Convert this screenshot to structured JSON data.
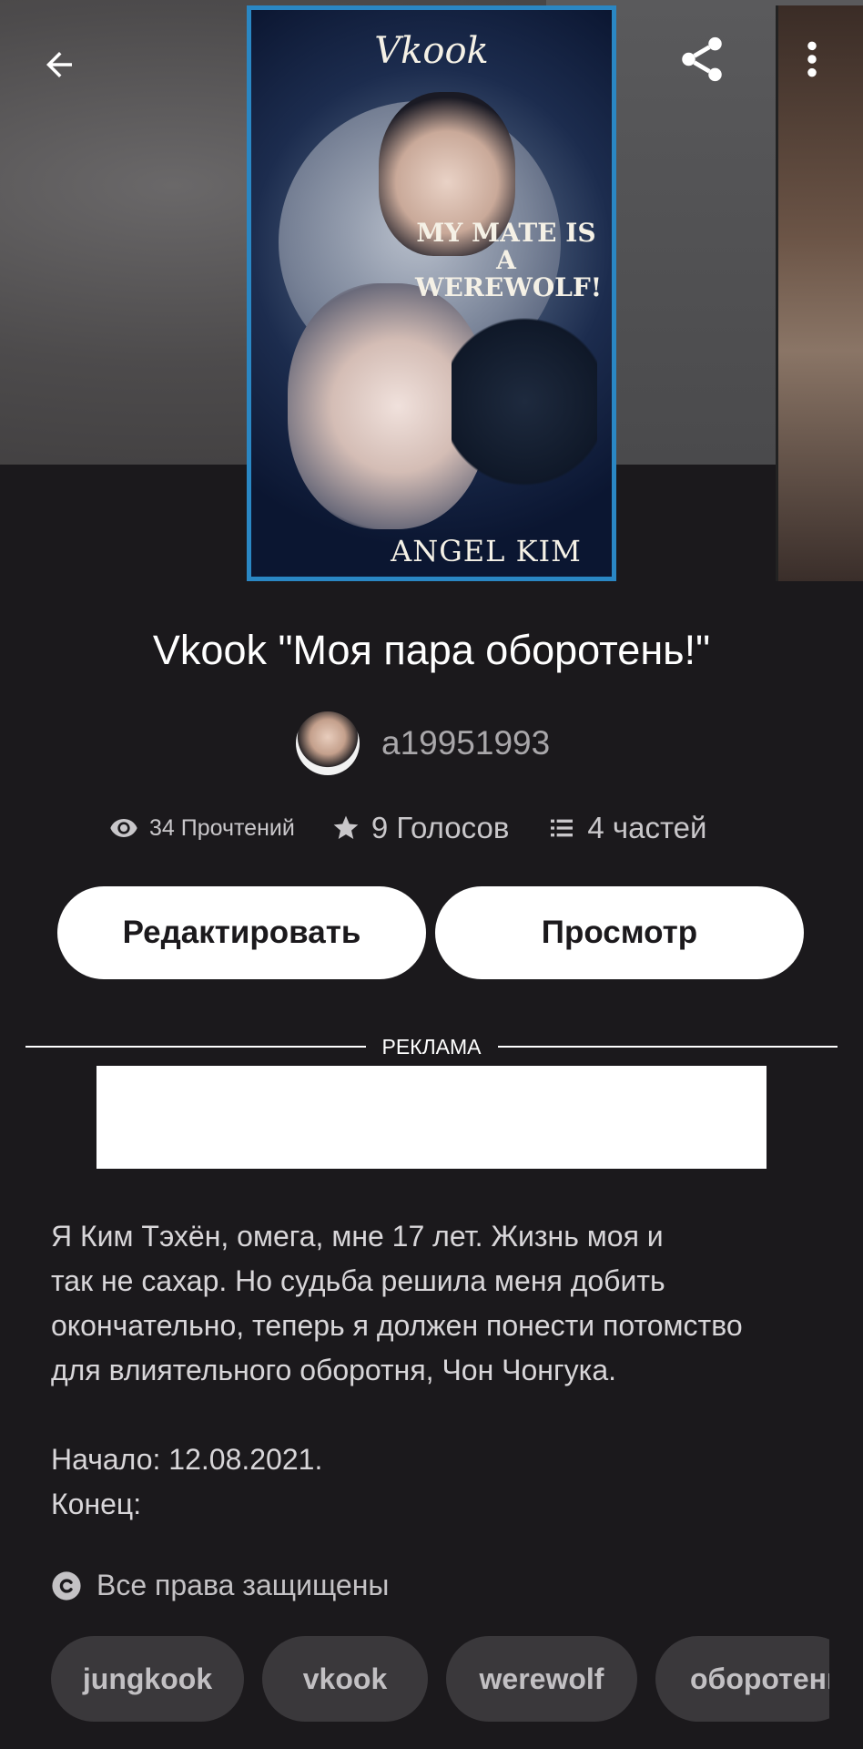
{
  "header": {
    "back_icon": "arrow-left-icon",
    "share_icon": "share-icon",
    "more_icon": "more-vertical-icon"
  },
  "cover": {
    "title_script": "Vkook",
    "tagline": "MY MATE IS A WEREWOLF!",
    "author_credit": "ANGEL KIM"
  },
  "story": {
    "title": "Vkook \"Моя пара оборотень!\"",
    "author": "a19951993"
  },
  "stats": {
    "reads": "34 Прочтений",
    "votes": "9 Голосов",
    "parts": "4 частей"
  },
  "buttons": {
    "edit": "Редактировать",
    "view": "Просмотр"
  },
  "ad": {
    "label": "РЕКЛАМА"
  },
  "description": "Я Ким Тэхён, омега, мне 17 лет. Жизнь моя и\nтак не сахар. Но судьба решила меня добить\nокончательно, теперь я должен понести потомство\nдля влиятельного оборотня, Чон Чонгука.\n\nНачало: 12.08.2021.\nКонец:",
  "copyright": "Все права защищены",
  "tags": [
    "jungkook",
    "vkook",
    "werewolf",
    "оборотень"
  ],
  "colors": {
    "background": "#1b191c",
    "cover_border": "#2a87c4",
    "button_bg": "#ffffff",
    "tag_bg": "#3a383b"
  }
}
